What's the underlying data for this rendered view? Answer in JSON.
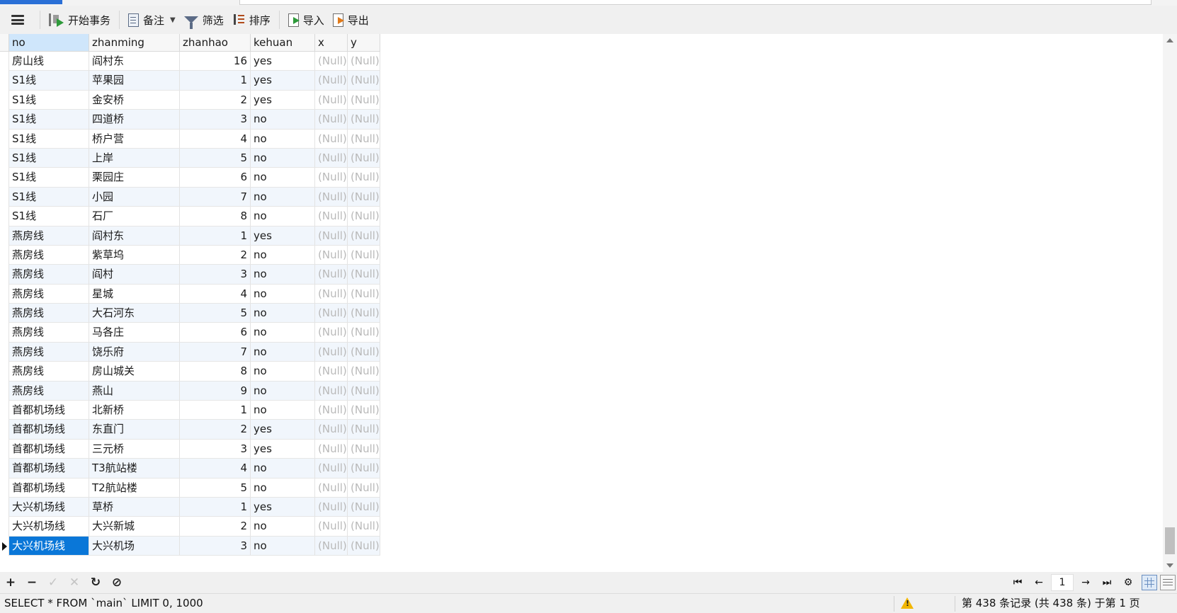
{
  "toolbar": {
    "menu_icon": "hamburger-icon",
    "begin_transaction": "开始事务",
    "note": "备注",
    "filter": "筛选",
    "sort": "排序",
    "import": "导入",
    "export": "导出"
  },
  "grid": {
    "columns": [
      "no",
      "zhanming",
      "zhanhao",
      "kehuan",
      "x",
      "y"
    ],
    "rows": [
      [
        "房山线",
        "阎村东",
        "16",
        "yes",
        "(Null)",
        "(Null)"
      ],
      [
        "S1线",
        "苹果园",
        "1",
        "yes",
        "(Null)",
        "(Null)"
      ],
      [
        "S1线",
        "金安桥",
        "2",
        "yes",
        "(Null)",
        "(Null)"
      ],
      [
        "S1线",
        "四道桥",
        "3",
        "no",
        "(Null)",
        "(Null)"
      ],
      [
        "S1线",
        "桥户营",
        "4",
        "no",
        "(Null)",
        "(Null)"
      ],
      [
        "S1线",
        "上岸",
        "5",
        "no",
        "(Null)",
        "(Null)"
      ],
      [
        "S1线",
        "栗园庄",
        "6",
        "no",
        "(Null)",
        "(Null)"
      ],
      [
        "S1线",
        "小园",
        "7",
        "no",
        "(Null)",
        "(Null)"
      ],
      [
        "S1线",
        "石厂",
        "8",
        "no",
        "(Null)",
        "(Null)"
      ],
      [
        "燕房线",
        "阎村东",
        "1",
        "yes",
        "(Null)",
        "(Null)"
      ],
      [
        "燕房线",
        "紫草坞",
        "2",
        "no",
        "(Null)",
        "(Null)"
      ],
      [
        "燕房线",
        "阎村",
        "3",
        "no",
        "(Null)",
        "(Null)"
      ],
      [
        "燕房线",
        "星城",
        "4",
        "no",
        "(Null)",
        "(Null)"
      ],
      [
        "燕房线",
        "大石河东",
        "5",
        "no",
        "(Null)",
        "(Null)"
      ],
      [
        "燕房线",
        "马各庄",
        "6",
        "no",
        "(Null)",
        "(Null)"
      ],
      [
        "燕房线",
        "饶乐府",
        "7",
        "no",
        "(Null)",
        "(Null)"
      ],
      [
        "燕房线",
        "房山城关",
        "8",
        "no",
        "(Null)",
        "(Null)"
      ],
      [
        "燕房线",
        "燕山",
        "9",
        "no",
        "(Null)",
        "(Null)"
      ],
      [
        "首都机场线",
        "北新桥",
        "1",
        "no",
        "(Null)",
        "(Null)"
      ],
      [
        "首都机场线",
        "东直门",
        "2",
        "yes",
        "(Null)",
        "(Null)"
      ],
      [
        "首都机场线",
        "三元桥",
        "3",
        "yes",
        "(Null)",
        "(Null)"
      ],
      [
        "首都机场线",
        "T3航站楼",
        "4",
        "no",
        "(Null)",
        "(Null)"
      ],
      [
        "首都机场线",
        "T2航站楼",
        "5",
        "no",
        "(Null)",
        "(Null)"
      ],
      [
        "大兴机场线",
        "草桥",
        "1",
        "yes",
        "(Null)",
        "(Null)"
      ],
      [
        "大兴机场线",
        "大兴新城",
        "2",
        "no",
        "(Null)",
        "(Null)"
      ],
      [
        "大兴机场线",
        "大兴机场",
        "3",
        "no",
        "(Null)",
        "(Null)"
      ]
    ],
    "current_row_index": 25,
    "selected_column": "no"
  },
  "bottom": {
    "add": "+",
    "delete": "−",
    "apply": "✓",
    "cancel": "✕",
    "refresh": "↻",
    "stop": "⊘",
    "first": "⏮",
    "prev": "←",
    "page": "1",
    "next": "→",
    "last": "⏭",
    "settings": "⚙"
  },
  "status": {
    "sql": "SELECT * FROM `main` LIMIT 0, 1000",
    "records": "第 438 条记录 (共 438 条) 于第 1 页"
  },
  "colors": {
    "selection": "#0a77d8",
    "null_text": "#b9b9b9",
    "alt_row": "#f1f6fc",
    "header_selected": "#cfe6fb"
  }
}
